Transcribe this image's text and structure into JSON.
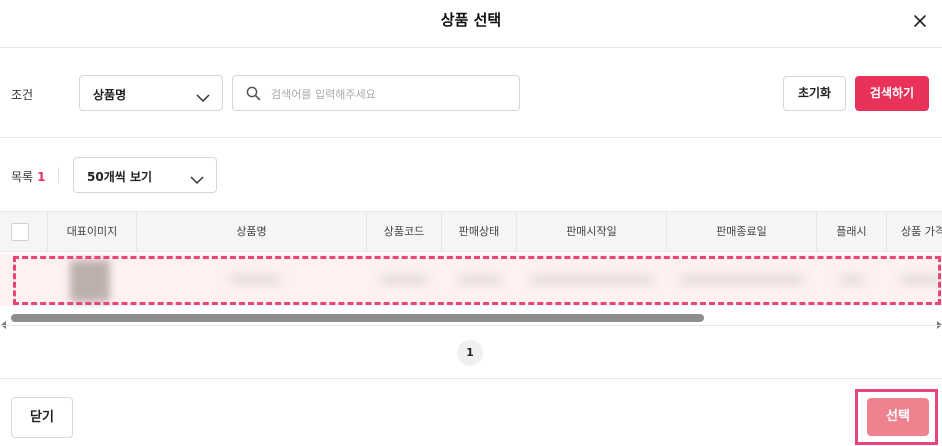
{
  "modal": {
    "title": "상품 선택"
  },
  "search": {
    "condition_label": "조건",
    "condition_value": "상품명",
    "placeholder": "검색어를 입력해주세요",
    "reset_label": "초기화",
    "search_label": "검색하기"
  },
  "list": {
    "label": "목록",
    "count": "1",
    "page_size": "50개씩 보기"
  },
  "table": {
    "columns": [
      "대표이미지",
      "상품명",
      "상품코드",
      "판매상태",
      "판매시작일",
      "판매종료일",
      "플래시",
      "상품 가격"
    ]
  },
  "pagination": {
    "current": "1"
  },
  "footer": {
    "close_label": "닫기",
    "select_label": "선택"
  },
  "colors": {
    "accent": "#e8325a",
    "highlight": "#e8467a",
    "select_disabled": "#f0818f"
  },
  "icons": {
    "close": "close-icon",
    "search": "search-icon",
    "dropdown": "chevron-down-icon"
  }
}
